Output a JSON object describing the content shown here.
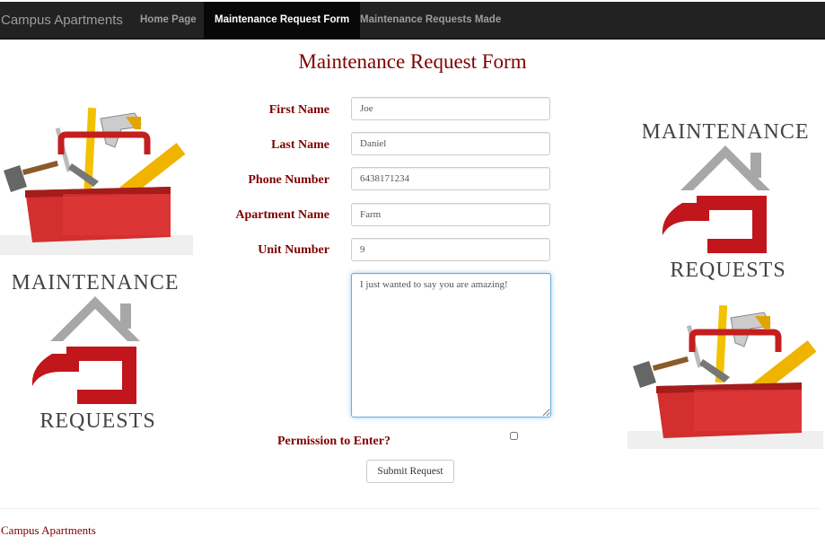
{
  "nav": {
    "brand": "Campus Apartments",
    "items": [
      {
        "label": "Home Page",
        "active": false
      },
      {
        "label": "Maintenance Request Form",
        "active": true
      },
      {
        "label": "Maintenance Requests Made",
        "active": false
      }
    ]
  },
  "page_title": "Maintenance Request Form",
  "form": {
    "first_name": {
      "label": "First Name",
      "value": "Joe"
    },
    "last_name": {
      "label": "Last Name",
      "value": "Daniel"
    },
    "phone_number": {
      "label": "Phone Number",
      "value": "6438171234"
    },
    "apartment_name": {
      "label": "Apartment Name",
      "value": "Farm"
    },
    "unit_number": {
      "label": "Unit Number",
      "value": "9"
    },
    "message": "I just wanted to say you are amazing!",
    "permission_label": "Permission to Enter?",
    "permission_checked": false,
    "submit_label": "Submit Request"
  },
  "logo": {
    "line1": "MAINTENANCE",
    "line2": "REQUESTS",
    "roof_color": "#a7a7a7",
    "hammer_color": "#c0161c"
  },
  "footer": "Campus Apartments",
  "icons": [
    "toolbox-icon",
    "maintenance-logo"
  ],
  "colors": {
    "accent": "#800000",
    "navbar": "#222222",
    "toolbox_red": "#d32f2f"
  }
}
